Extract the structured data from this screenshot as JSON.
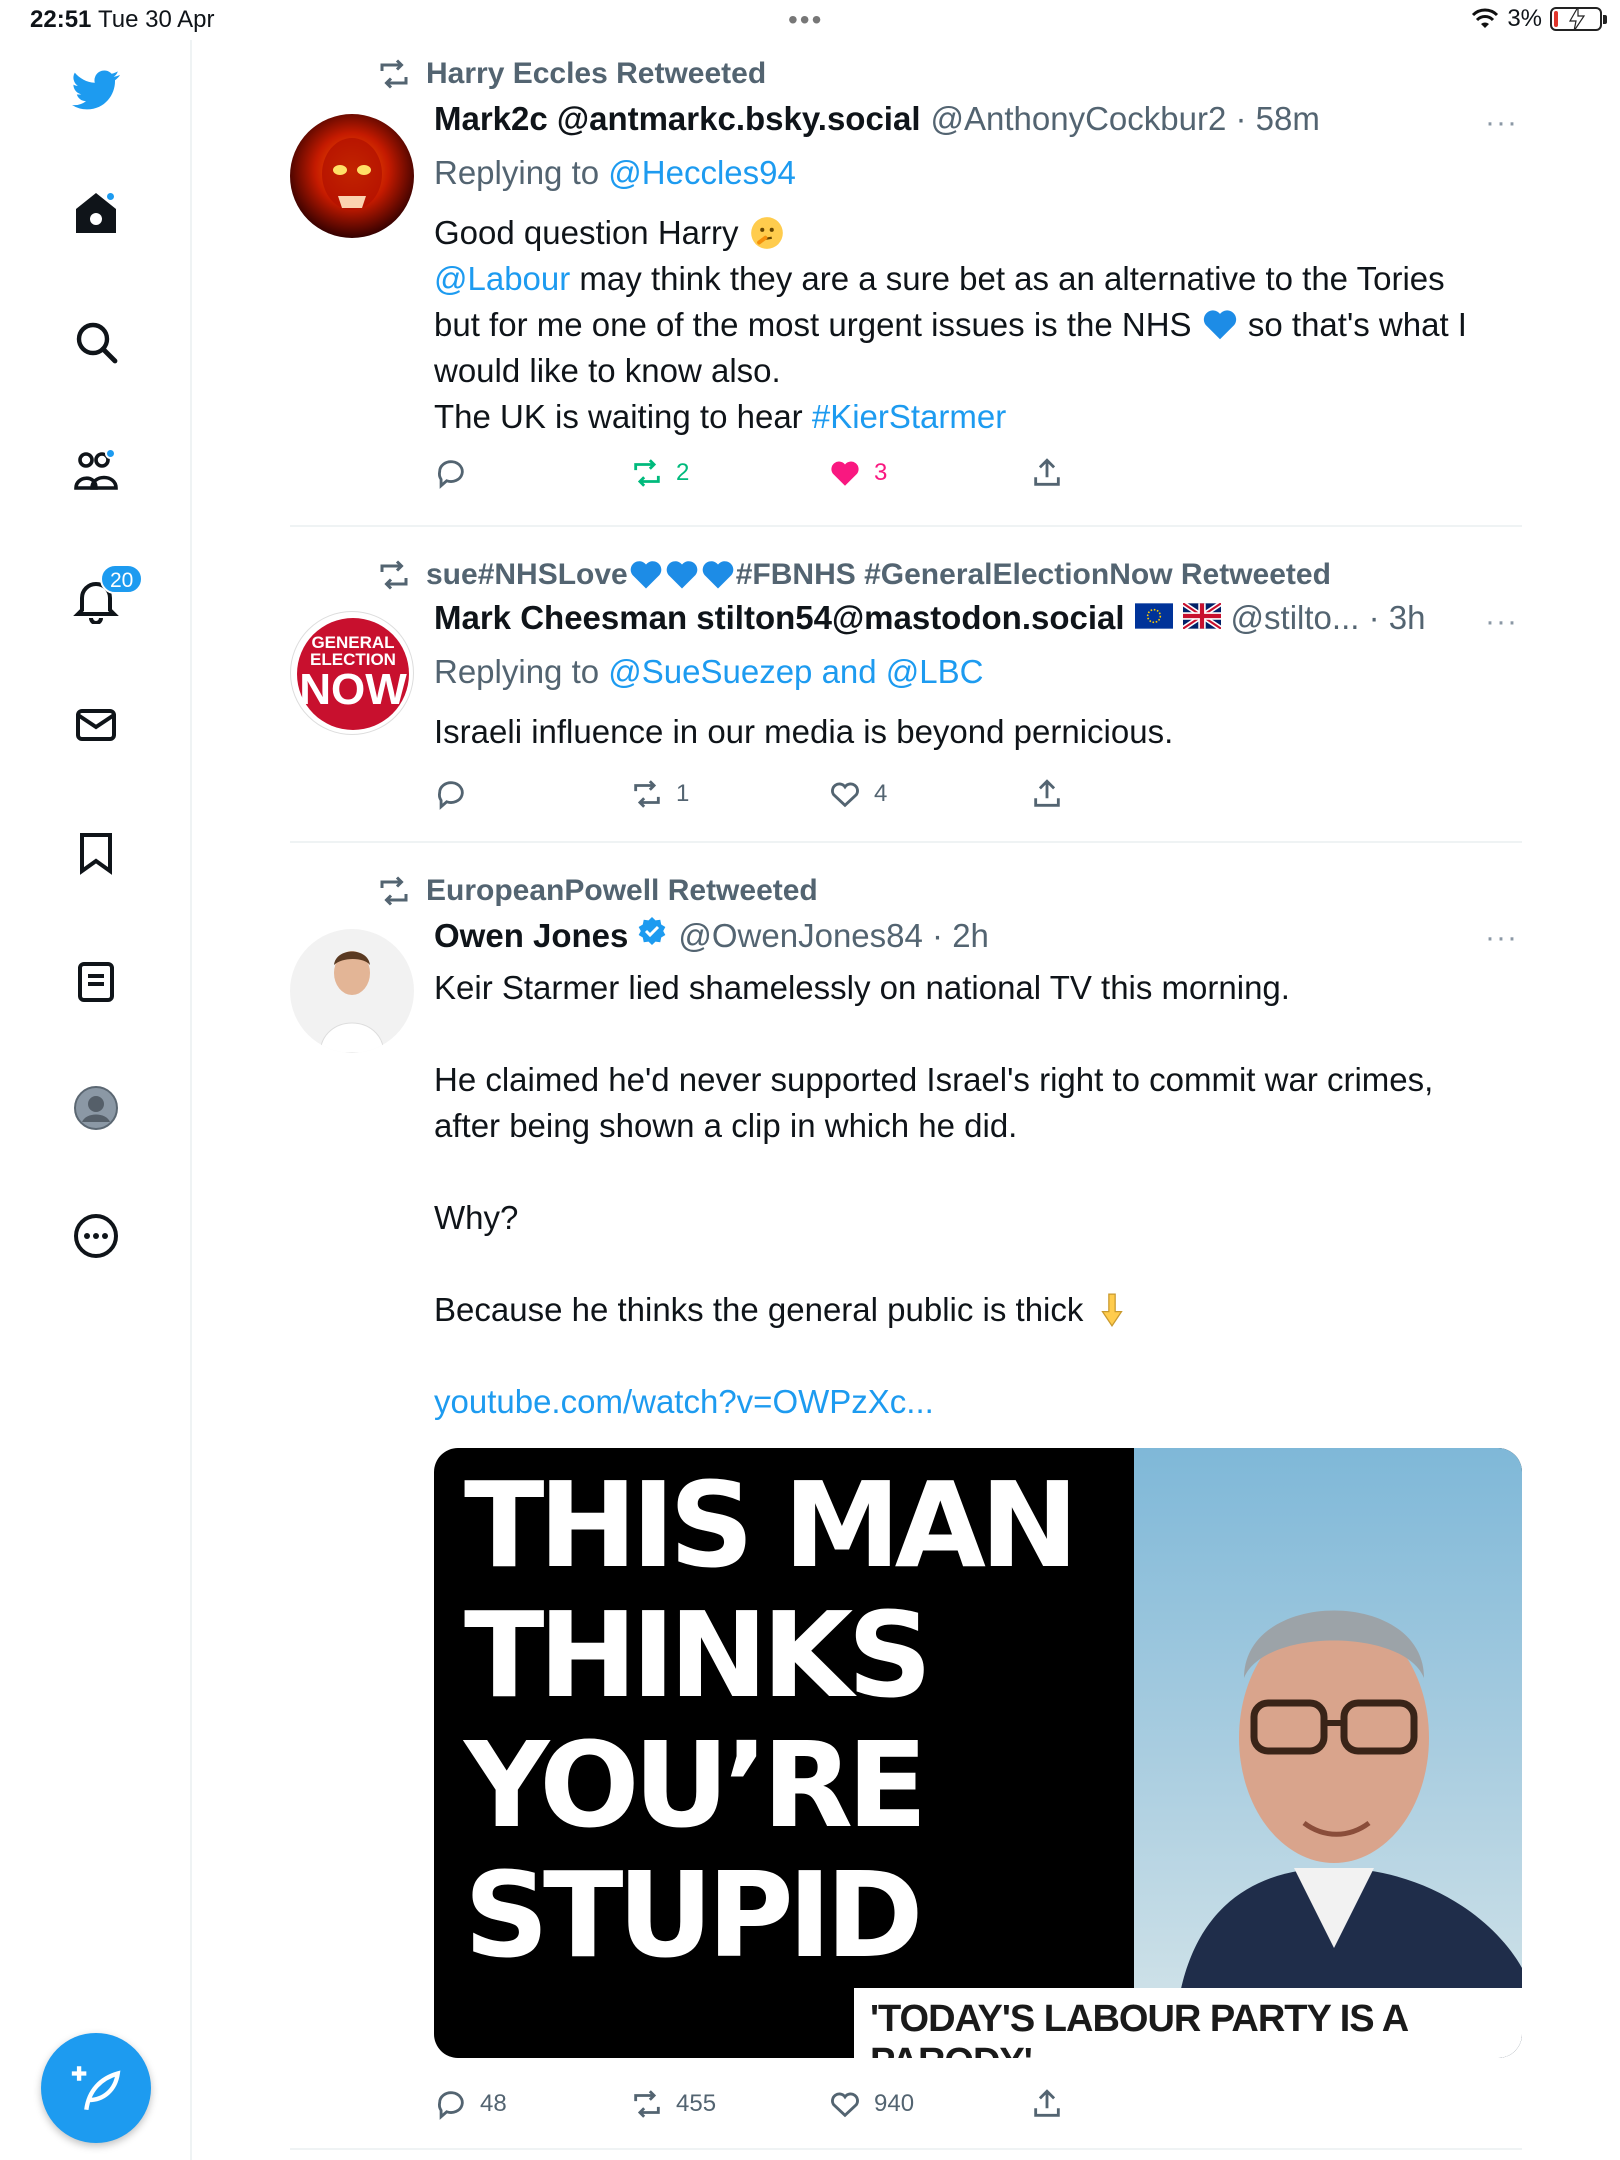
{
  "status_bar": {
    "time": "22:51",
    "date": "Tue 30 Apr",
    "battery": "3%"
  },
  "sidebar": {
    "notifications_count": "20"
  },
  "tweets": [
    {
      "retweeted_by": "Harry Eccles Retweeted",
      "name": "Mark2c @antmarkc.bsky.social",
      "handle": "@AnthonyCockbur2 · 58m",
      "replying_prefix": "Replying to ",
      "replying_to": "@Heccles94",
      "line1": "Good question Harry",
      "mention": "@Labour",
      "line2": " may think they are a sure bet as an alternative to the Tories",
      "line3a": "but for me one of the most urgent issues is the NHS",
      "line3b": " so that's what I",
      "line4": "would like to know also.",
      "line5": "The UK is waiting to hear ",
      "hashtag": "#KierStarmer",
      "retweets": "2",
      "likes": "3",
      "more": "···"
    },
    {
      "retweeted_by_a": "sue#NHSLove",
      "retweeted_by_b": "#FBNHS #GeneralElectionNow Retweeted",
      "name": "Mark Cheesman stilton54@mastodon.social",
      "handle": "@stilto... · 3h",
      "replying_prefix": "Replying to ",
      "replying_to": "@SueSuezep and @LBC",
      "text": "Israeli influence in our media is beyond pernicious.",
      "retweets": "1",
      "likes": "4",
      "more": "···",
      "avatar_text": [
        "GENERAL",
        "ELECTION",
        "NOW"
      ]
    },
    {
      "retweeted_by": "EuropeanPowell Retweeted",
      "name": "Owen Jones",
      "handle": "@OwenJones84 · 2h",
      "p1": "Keir Starmer lied shamelessly on national TV this morning.",
      "p2a": "He claimed he'd never supported Israel's right to commit war crimes,",
      "p2b": "after being shown a clip in which he did.",
      "p3": "Why?",
      "p4": "Because he thinks the general public is thick",
      "link": "youtube.com/watch?v=OWPzXc...",
      "card_line1": "THIS MAN",
      "card_line2": "THINKS",
      "card_line3": "YOU’RE",
      "card_line4": "STUPID",
      "card_strip": "'TODAY'S LABOUR PARTY IS A PARODY'",
      "replies": "48",
      "retweets": "455",
      "likes": "940",
      "more": "···"
    }
  ],
  "colors": {
    "accent": "#1d9bf0",
    "retweet_green": "#00ba7c",
    "like_pink": "#f91880",
    "muted": "#536471"
  }
}
